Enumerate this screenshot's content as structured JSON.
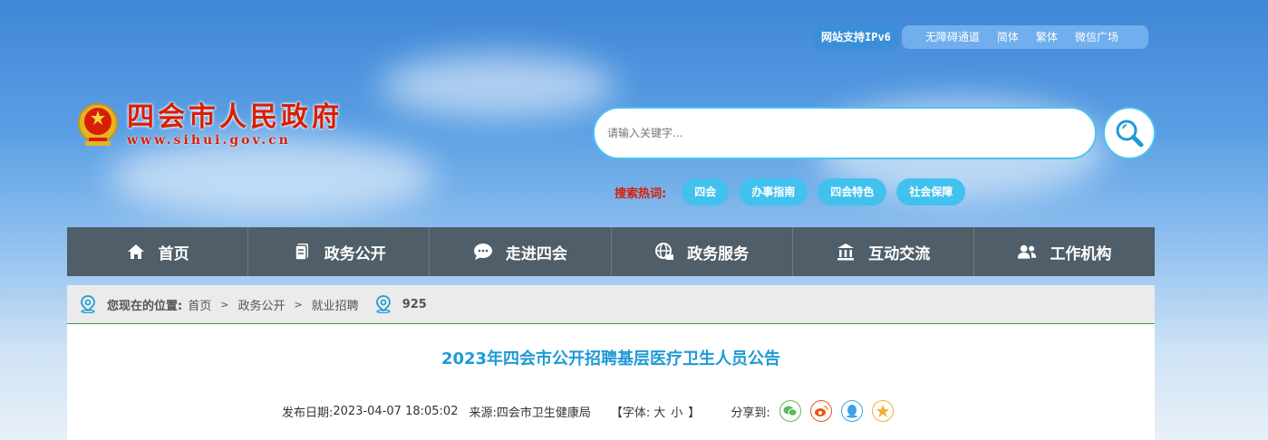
{
  "topbar": {
    "ipv6": "网站支持IPv6",
    "links": [
      "无障碍通道",
      "简体",
      "繁体",
      "微信广场"
    ]
  },
  "logo": {
    "cn": "四会市人民政府",
    "en": "www.sihui.gov.cn"
  },
  "search": {
    "placeholder": "请输入关键字..."
  },
  "hot": {
    "label": "搜索热词:",
    "tags": [
      "四会",
      "办事指南",
      "四会特色",
      "社会保障"
    ]
  },
  "nav": [
    {
      "label": "首页",
      "icon": "home-icon"
    },
    {
      "label": "政务公开",
      "icon": "document-icon"
    },
    {
      "label": "走进四会",
      "icon": "chat-icon"
    },
    {
      "label": "政务服务",
      "icon": "globe-icon"
    },
    {
      "label": "互动交流",
      "icon": "building-icon"
    },
    {
      "label": "工作机构",
      "icon": "users-icon"
    }
  ],
  "breadcrumb": {
    "label": "您现在的位置:",
    "items": [
      "首页",
      "政务公开",
      "就业招聘"
    ],
    "views": "925"
  },
  "article": {
    "title": "2023年四会市公开招聘基层医疗卫生人员公告",
    "date_label": "发布日期:",
    "date": "2023-04-07 18:05:02",
    "source_label": "来源:",
    "source": "四会市卫生健康局",
    "font_label": "【字体:",
    "font_large": "大",
    "font_small": "小",
    "font_end": "】",
    "share_label": "分享到:"
  },
  "colors": {
    "accent": "#41c2ee",
    "title": "#1e9ad6",
    "nav_bg": "#4f5e69",
    "brand_red": "#d81e06"
  }
}
